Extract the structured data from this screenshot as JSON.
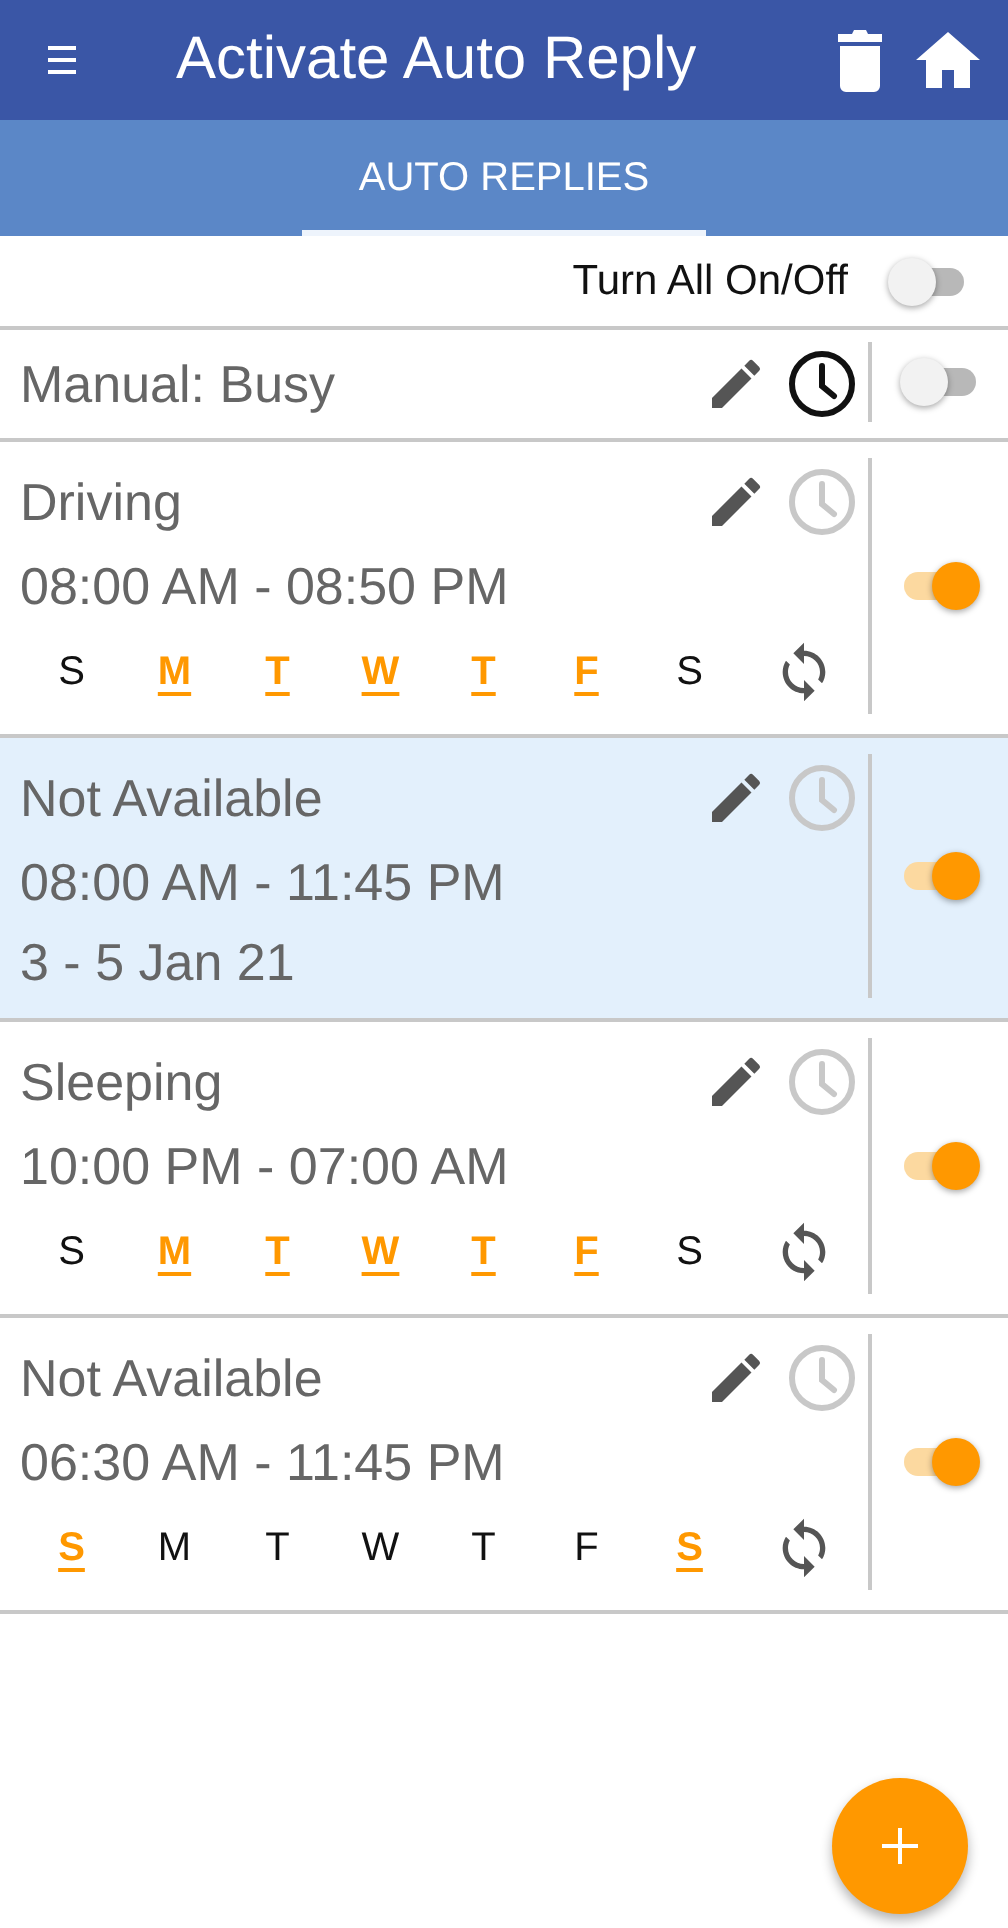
{
  "app_bar": {
    "title": "Activate Auto Reply"
  },
  "tabs": [
    {
      "label": "AUTO REPLIES",
      "selected": true
    }
  ],
  "master_switch": {
    "label": "Turn All On/Off",
    "on": false
  },
  "replies": [
    {
      "kind": "manual",
      "title": "Manual: Busy",
      "clock_active": true,
      "on": false,
      "selected": false
    },
    {
      "kind": "weekly",
      "title": "Driving",
      "time": "08:00 AM - 08:50 PM",
      "clock_active": false,
      "on": true,
      "selected": false,
      "days": [
        {
          "label": "S",
          "on": false
        },
        {
          "label": "M",
          "on": true
        },
        {
          "label": "T",
          "on": true
        },
        {
          "label": "W",
          "on": true
        },
        {
          "label": "T",
          "on": true
        },
        {
          "label": "F",
          "on": true
        },
        {
          "label": "S",
          "on": false
        }
      ]
    },
    {
      "kind": "dated",
      "title": "Not Available",
      "time": "08:00 AM - 11:45 PM",
      "date": "3 - 5 Jan 21",
      "clock_active": false,
      "on": true,
      "selected": true
    },
    {
      "kind": "weekly",
      "title": "Sleeping",
      "time": "10:00 PM - 07:00 AM",
      "clock_active": false,
      "on": true,
      "selected": false,
      "days": [
        {
          "label": "S",
          "on": false
        },
        {
          "label": "M",
          "on": true
        },
        {
          "label": "T",
          "on": true
        },
        {
          "label": "W",
          "on": true
        },
        {
          "label": "T",
          "on": true
        },
        {
          "label": "F",
          "on": true
        },
        {
          "label": "S",
          "on": false
        }
      ]
    },
    {
      "kind": "weekly",
      "title": "Not Available",
      "time": "06:30 AM - 11:45 PM",
      "clock_active": false,
      "on": true,
      "selected": false,
      "days": [
        {
          "label": "S",
          "on": true
        },
        {
          "label": "M",
          "on": false
        },
        {
          "label": "T",
          "on": false
        },
        {
          "label": "W",
          "on": false
        },
        {
          "label": "T",
          "on": false
        },
        {
          "label": "F",
          "on": false
        },
        {
          "label": "S",
          "on": true
        }
      ]
    }
  ]
}
